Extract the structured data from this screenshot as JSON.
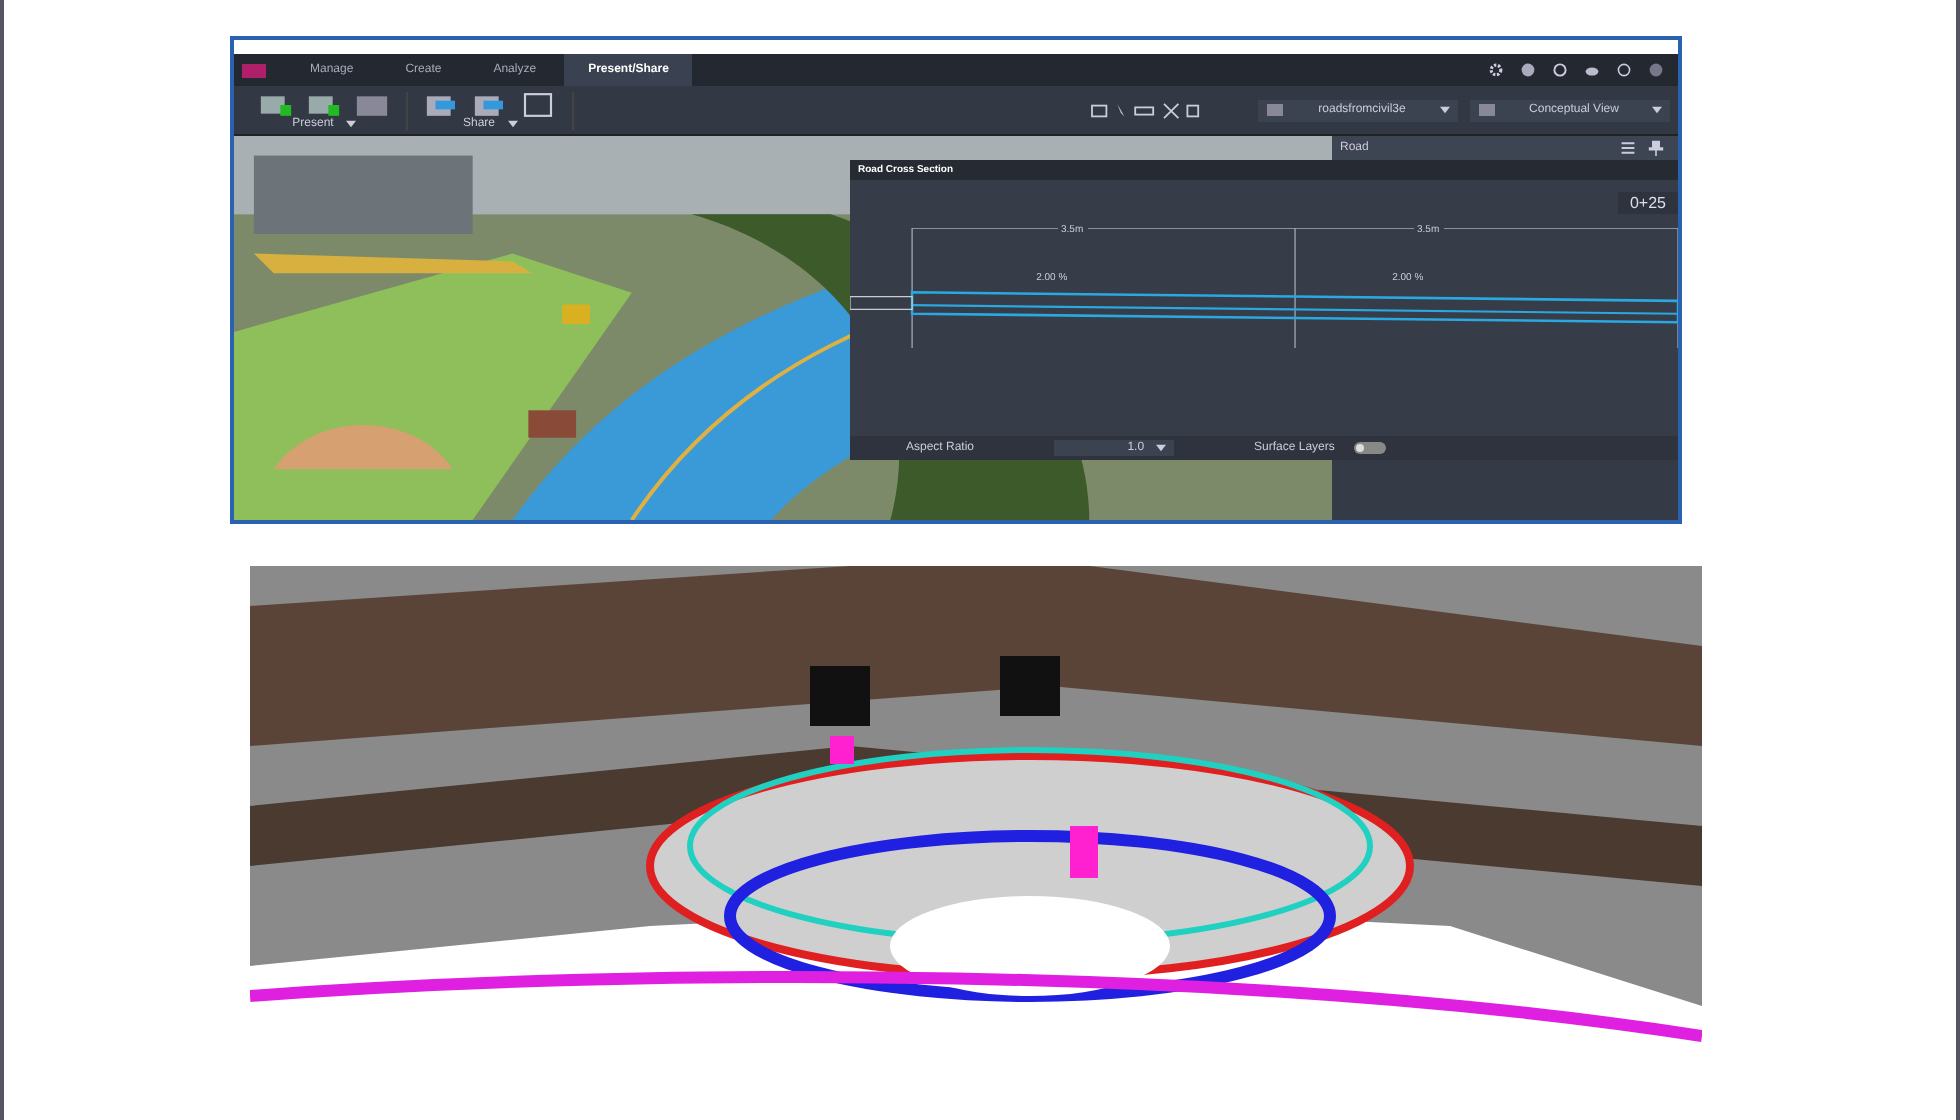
{
  "app_screenshot": {
    "tabs": [
      {
        "label": "Manage",
        "selected": false
      },
      {
        "label": "Create",
        "selected": false
      },
      {
        "label": "Analyze",
        "selected": false
      },
      {
        "label": "Present/Share",
        "selected": true
      }
    ],
    "toolbar_groups": [
      {
        "label": "Present"
      },
      {
        "label": "Share"
      }
    ],
    "view_selectors": [
      {
        "label": "roadsfromcivil3e"
      },
      {
        "label": "Conceptual View"
      }
    ],
    "side_panel": {
      "title": "Road"
    },
    "cross_section": {
      "title": "Road Cross Section",
      "station": "0+25",
      "lane_widths": [
        "3.5m",
        "3.5m"
      ],
      "slopes": [
        "2.00 %",
        "2.00 %"
      ],
      "aspect_ratio_label": "Aspect Ratio",
      "aspect_ratio": "1.0",
      "surface_layers_label": "Surface Layers",
      "surface_layers_on": false
    }
  }
}
